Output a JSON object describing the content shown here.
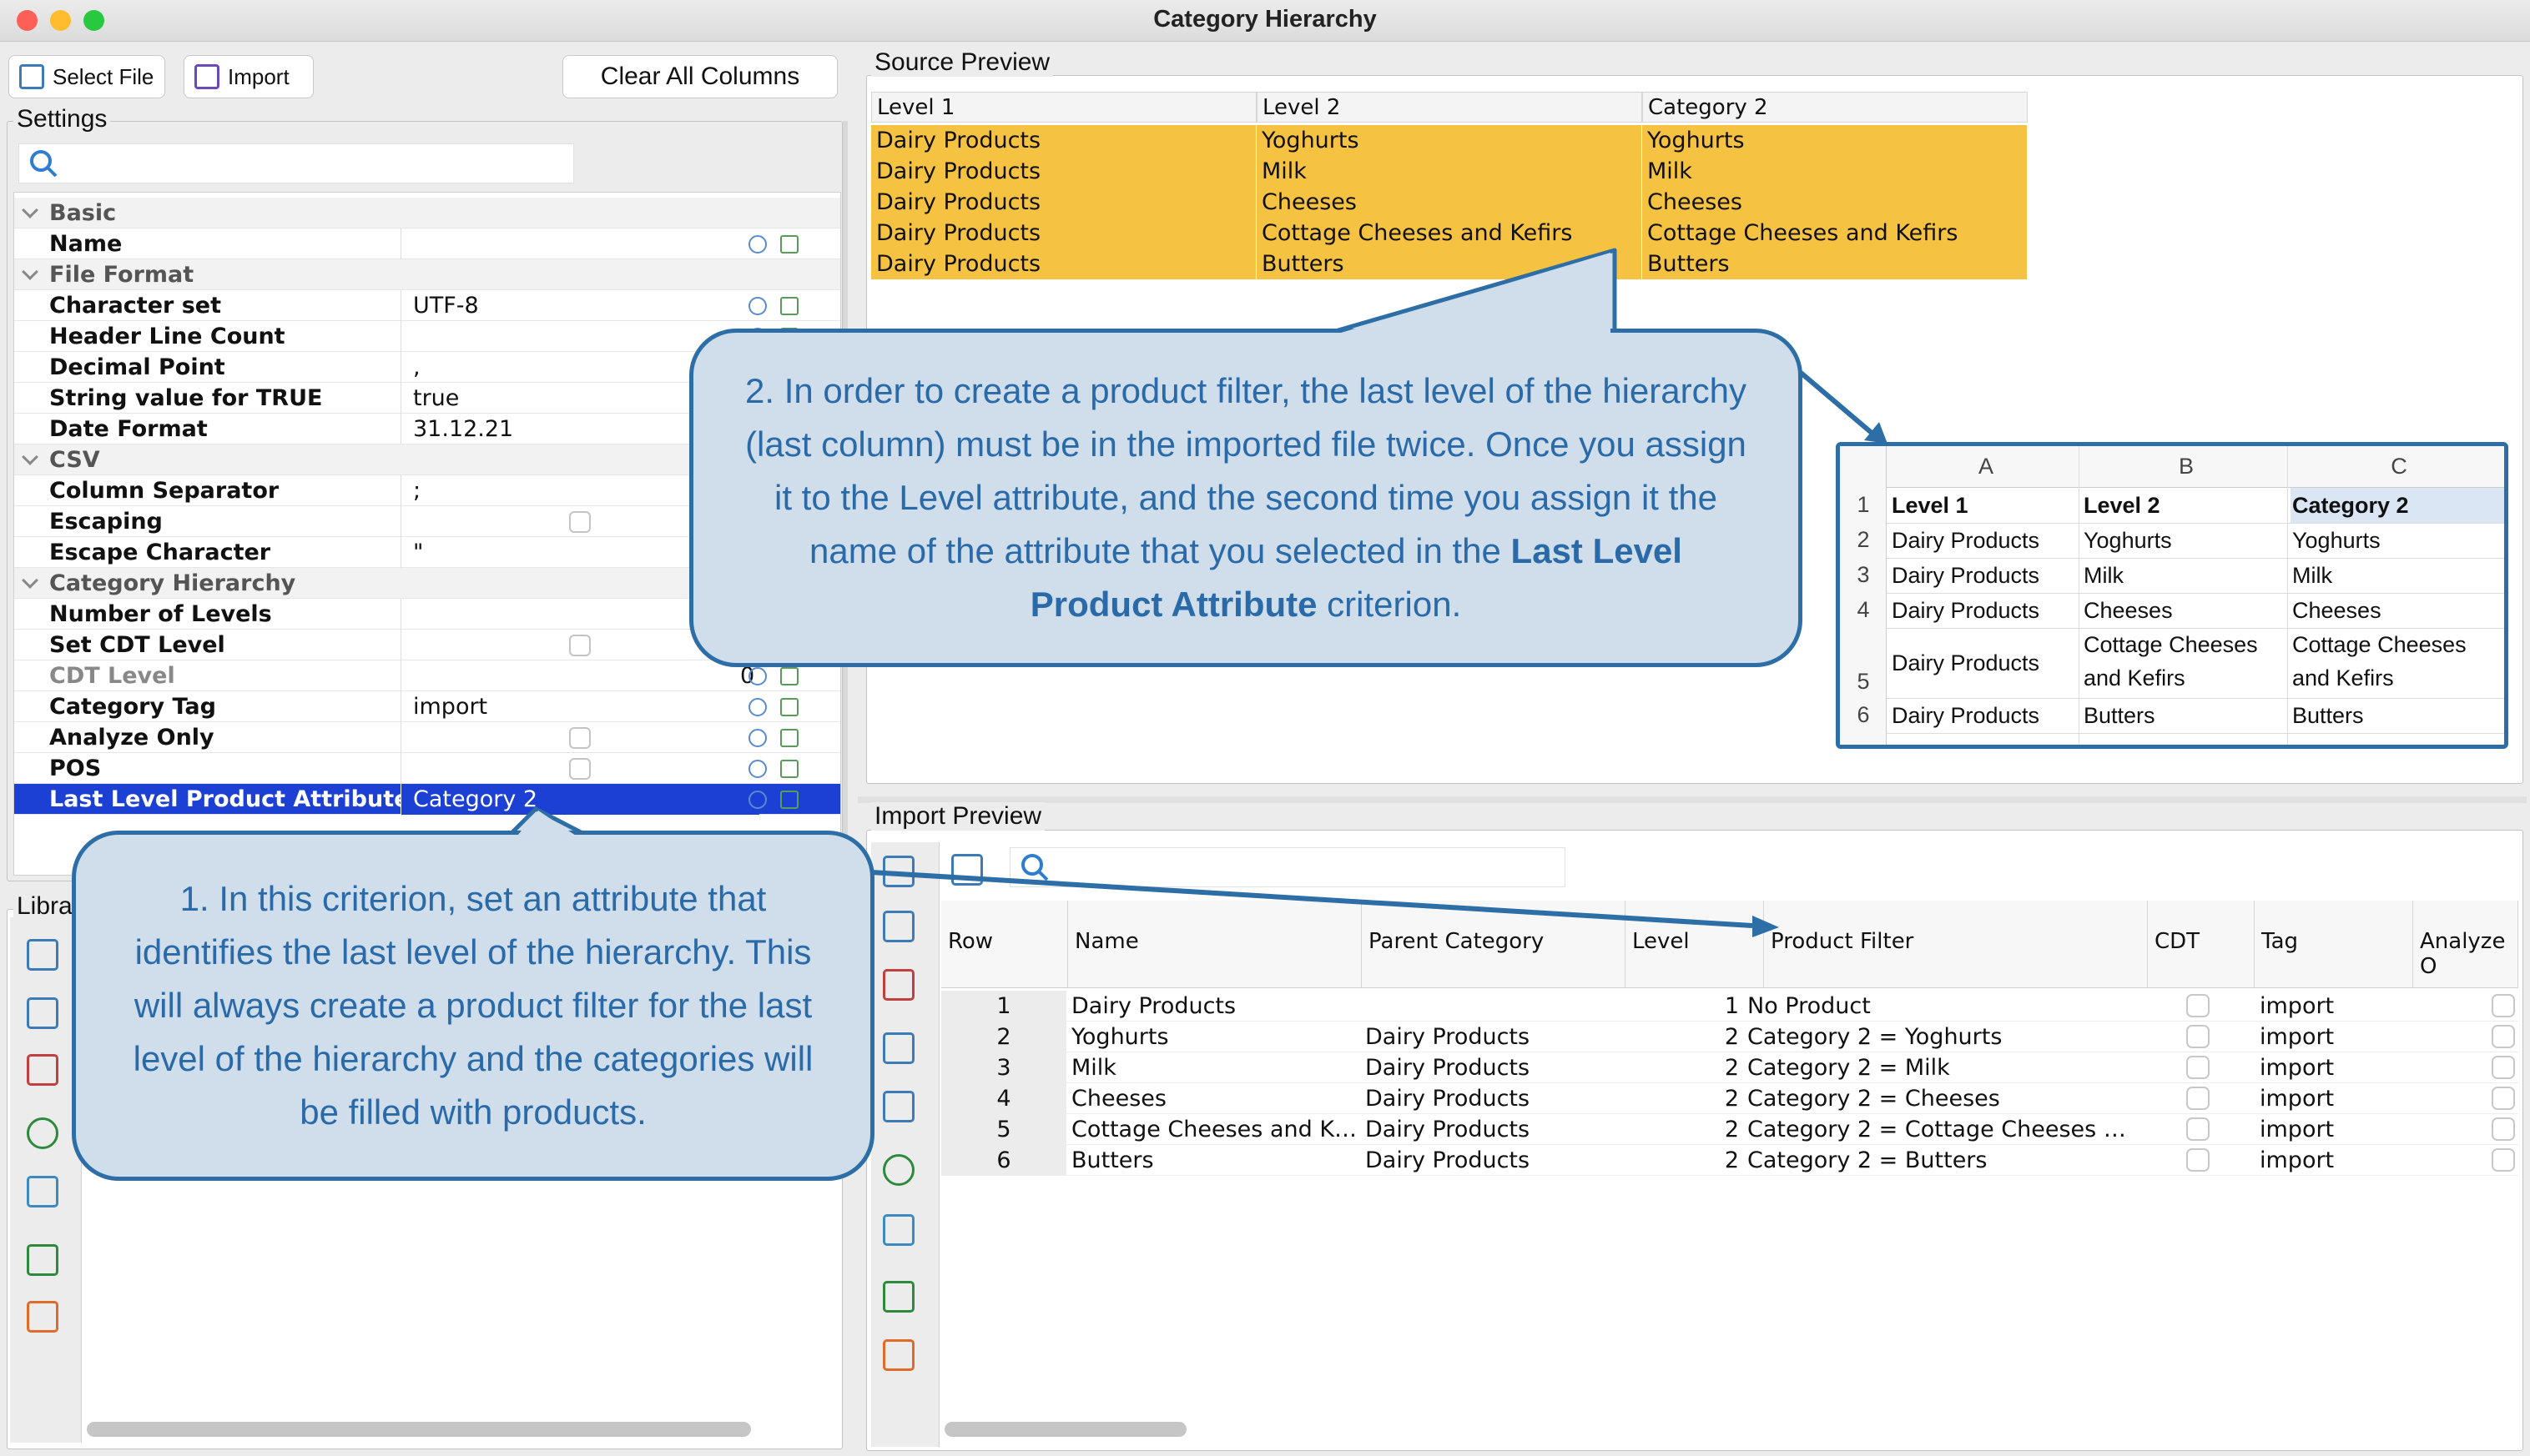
{
  "window": {
    "title": "Category Hierarchy"
  },
  "toolbar": {
    "select_file": "Select File",
    "import": "Import",
    "clear_all": "Clear All Columns"
  },
  "settings": {
    "label": "Settings",
    "rows": [
      {
        "key": "Basic",
        "section": true
      },
      {
        "key": "Name",
        "value": ""
      },
      {
        "key": "File Format",
        "section": true
      },
      {
        "key": "Character set",
        "value": "UTF-8"
      },
      {
        "key": "Header Line Count",
        "value": ""
      },
      {
        "key": "Decimal Point",
        "value": ","
      },
      {
        "key": "String value for TRUE",
        "value": "true"
      },
      {
        "key": "Date Format",
        "value": "31.12.21"
      },
      {
        "key": "CSV",
        "section": true
      },
      {
        "key": "Column Separator",
        "value": ";"
      },
      {
        "key": "Escaping",
        "value": ""
      },
      {
        "key": "Escape Character",
        "value": "\""
      },
      {
        "key": "Category Hierarchy",
        "section": true
      },
      {
        "key": "Number of Levels",
        "value": ""
      },
      {
        "key": "Set CDT Level",
        "value": ""
      },
      {
        "key": "CDT Level",
        "value": "",
        "extra": "0"
      },
      {
        "key": "Category Tag",
        "value": "import"
      },
      {
        "key": "Analyze Only",
        "value": ""
      },
      {
        "key": "POS",
        "value": ""
      },
      {
        "key": "Last Level Product Attribute",
        "value": "Category 2"
      }
    ]
  },
  "library": {
    "label": "Libra"
  },
  "source_preview": {
    "label": "Source Preview",
    "headers": [
      "Level 1",
      "Level 2",
      "Category 2"
    ],
    "rows": [
      [
        "Dairy Products",
        "Yoghurts",
        "Yoghurts"
      ],
      [
        "Dairy Products",
        "Milk",
        "Milk"
      ],
      [
        "Dairy Products",
        "Cheeses",
        "Cheeses"
      ],
      [
        "Dairy Products",
        "Cottage Cheeses and Kefirs",
        "Cottage Cheeses and Kefirs"
      ],
      [
        "Dairy Products",
        "Butters",
        "Butters"
      ]
    ]
  },
  "excel": {
    "cols": [
      "A",
      "B",
      "C"
    ],
    "rownums": [
      "1",
      "2",
      "3",
      "4",
      "5",
      "6"
    ],
    "rows": [
      [
        "Level 1",
        "Level 2",
        "Category 2"
      ],
      [
        "Dairy Products",
        "Yoghurts",
        "Yoghurts"
      ],
      [
        "Dairy Products",
        "Milk",
        "Milk"
      ],
      [
        "Dairy Products",
        "Cheeses",
        "Cheeses"
      ],
      [
        "Dairy Products",
        "Cottage Cheeses\nand Kefirs",
        "Cottage Cheeses\nand Kefirs"
      ],
      [
        "Dairy Products",
        "Butters",
        "Butters"
      ]
    ]
  },
  "import_preview": {
    "label": "Import Preview",
    "headers": [
      "Row",
      "Name",
      "Parent Category",
      "Level",
      "Product Filter",
      "CDT",
      "Tag",
      "Analyze O"
    ],
    "rows": [
      {
        "row": "1",
        "name": "Dairy Products",
        "parent": "",
        "level": "1",
        "filter": "No Product",
        "tag": "import"
      },
      {
        "row": "2",
        "name": "Yoghurts",
        "parent": "Dairy Products",
        "level": "2",
        "filter": "Category 2  =  Yoghurts",
        "tag": "import"
      },
      {
        "row": "3",
        "name": "Milk",
        "parent": "Dairy Products",
        "level": "2",
        "filter": "Category 2  =  Milk",
        "tag": "import"
      },
      {
        "row": "4",
        "name": "Cheeses",
        "parent": "Dairy Products",
        "level": "2",
        "filter": "Category 2  =  Cheeses",
        "tag": "import"
      },
      {
        "row": "5",
        "name": "Cottage Cheeses and K…",
        "parent": "Dairy Products",
        "level": "2",
        "filter": "Category 2  =  Cottage Cheeses …",
        "tag": "import"
      },
      {
        "row": "6",
        "name": "Butters",
        "parent": "Dairy Products",
        "level": "2",
        "filter": "Category 2  =  Butters",
        "tag": "import"
      }
    ]
  },
  "callouts": {
    "c1": "1. In this criterion, set an attribute that identifies the last level of the hierarchy. This will always create a product filter for the last level of the hierarchy and the categories will be filled with products.",
    "c2_pre": "2. In order to create a product filter, the last level of the hierarchy (last column) must be in the imported file twice. Once you assign it to the Level attribute, and the second time you assign it the name of the attribute that you selected in the ",
    "c2_bold": "Last Level Product Attribute",
    "c2_post": " criterion."
  },
  "colors": {
    "highlight": "#f5c242",
    "selection": "#1c3fd4",
    "callout_border": "#2e6ea7",
    "callout_fill": "#cfdeea"
  },
  "icons": [
    "select-file-icon",
    "import-icon",
    "search-icon",
    "checklist-icon",
    "copy-icon",
    "help-icon",
    "excel-icon",
    "csv-icon",
    "table-icon",
    "chart-icon"
  ]
}
